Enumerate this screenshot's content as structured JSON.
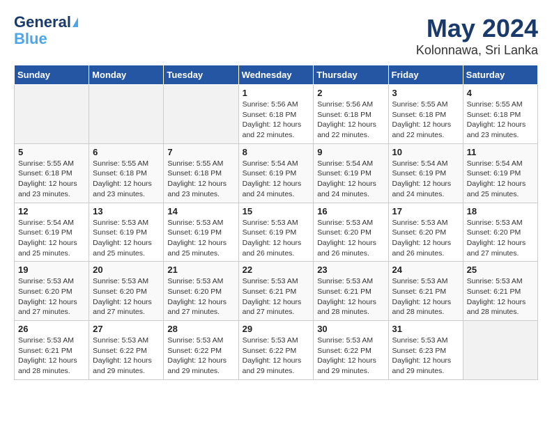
{
  "logo": {
    "line1": "General",
    "line2": "Blue"
  },
  "title": "May 2024",
  "subtitle": "Kolonnawa, Sri Lanka",
  "weekdays": [
    "Sunday",
    "Monday",
    "Tuesday",
    "Wednesday",
    "Thursday",
    "Friday",
    "Saturday"
  ],
  "weeks": [
    [
      {
        "day": "",
        "info": ""
      },
      {
        "day": "",
        "info": ""
      },
      {
        "day": "",
        "info": ""
      },
      {
        "day": "1",
        "info": "Sunrise: 5:56 AM\nSunset: 6:18 PM\nDaylight: 12 hours and 22 minutes."
      },
      {
        "day": "2",
        "info": "Sunrise: 5:56 AM\nSunset: 6:18 PM\nDaylight: 12 hours and 22 minutes."
      },
      {
        "day": "3",
        "info": "Sunrise: 5:55 AM\nSunset: 6:18 PM\nDaylight: 12 hours and 22 minutes."
      },
      {
        "day": "4",
        "info": "Sunrise: 5:55 AM\nSunset: 6:18 PM\nDaylight: 12 hours and 23 minutes."
      }
    ],
    [
      {
        "day": "5",
        "info": "Sunrise: 5:55 AM\nSunset: 6:18 PM\nDaylight: 12 hours and 23 minutes."
      },
      {
        "day": "6",
        "info": "Sunrise: 5:55 AM\nSunset: 6:18 PM\nDaylight: 12 hours and 23 minutes."
      },
      {
        "day": "7",
        "info": "Sunrise: 5:55 AM\nSunset: 6:18 PM\nDaylight: 12 hours and 23 minutes."
      },
      {
        "day": "8",
        "info": "Sunrise: 5:54 AM\nSunset: 6:19 PM\nDaylight: 12 hours and 24 minutes."
      },
      {
        "day": "9",
        "info": "Sunrise: 5:54 AM\nSunset: 6:19 PM\nDaylight: 12 hours and 24 minutes."
      },
      {
        "day": "10",
        "info": "Sunrise: 5:54 AM\nSunset: 6:19 PM\nDaylight: 12 hours and 24 minutes."
      },
      {
        "day": "11",
        "info": "Sunrise: 5:54 AM\nSunset: 6:19 PM\nDaylight: 12 hours and 25 minutes."
      }
    ],
    [
      {
        "day": "12",
        "info": "Sunrise: 5:54 AM\nSunset: 6:19 PM\nDaylight: 12 hours and 25 minutes."
      },
      {
        "day": "13",
        "info": "Sunrise: 5:53 AM\nSunset: 6:19 PM\nDaylight: 12 hours and 25 minutes."
      },
      {
        "day": "14",
        "info": "Sunrise: 5:53 AM\nSunset: 6:19 PM\nDaylight: 12 hours and 25 minutes."
      },
      {
        "day": "15",
        "info": "Sunrise: 5:53 AM\nSunset: 6:19 PM\nDaylight: 12 hours and 26 minutes."
      },
      {
        "day": "16",
        "info": "Sunrise: 5:53 AM\nSunset: 6:20 PM\nDaylight: 12 hours and 26 minutes."
      },
      {
        "day": "17",
        "info": "Sunrise: 5:53 AM\nSunset: 6:20 PM\nDaylight: 12 hours and 26 minutes."
      },
      {
        "day": "18",
        "info": "Sunrise: 5:53 AM\nSunset: 6:20 PM\nDaylight: 12 hours and 27 minutes."
      }
    ],
    [
      {
        "day": "19",
        "info": "Sunrise: 5:53 AM\nSunset: 6:20 PM\nDaylight: 12 hours and 27 minutes."
      },
      {
        "day": "20",
        "info": "Sunrise: 5:53 AM\nSunset: 6:20 PM\nDaylight: 12 hours and 27 minutes."
      },
      {
        "day": "21",
        "info": "Sunrise: 5:53 AM\nSunset: 6:20 PM\nDaylight: 12 hours and 27 minutes."
      },
      {
        "day": "22",
        "info": "Sunrise: 5:53 AM\nSunset: 6:21 PM\nDaylight: 12 hours and 27 minutes."
      },
      {
        "day": "23",
        "info": "Sunrise: 5:53 AM\nSunset: 6:21 PM\nDaylight: 12 hours and 28 minutes."
      },
      {
        "day": "24",
        "info": "Sunrise: 5:53 AM\nSunset: 6:21 PM\nDaylight: 12 hours and 28 minutes."
      },
      {
        "day": "25",
        "info": "Sunrise: 5:53 AM\nSunset: 6:21 PM\nDaylight: 12 hours and 28 minutes."
      }
    ],
    [
      {
        "day": "26",
        "info": "Sunrise: 5:53 AM\nSunset: 6:21 PM\nDaylight: 12 hours and 28 minutes."
      },
      {
        "day": "27",
        "info": "Sunrise: 5:53 AM\nSunset: 6:22 PM\nDaylight: 12 hours and 29 minutes."
      },
      {
        "day": "28",
        "info": "Sunrise: 5:53 AM\nSunset: 6:22 PM\nDaylight: 12 hours and 29 minutes."
      },
      {
        "day": "29",
        "info": "Sunrise: 5:53 AM\nSunset: 6:22 PM\nDaylight: 12 hours and 29 minutes."
      },
      {
        "day": "30",
        "info": "Sunrise: 5:53 AM\nSunset: 6:22 PM\nDaylight: 12 hours and 29 minutes."
      },
      {
        "day": "31",
        "info": "Sunrise: 5:53 AM\nSunset: 6:23 PM\nDaylight: 12 hours and 29 minutes."
      },
      {
        "day": "",
        "info": ""
      }
    ]
  ]
}
